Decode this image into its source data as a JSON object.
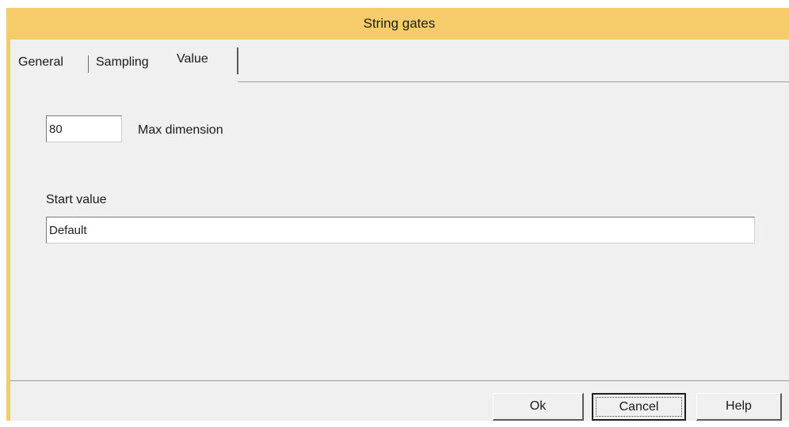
{
  "window": {
    "title": "String gates",
    "accent_color": "#f6cc6a",
    "background_color": "#f0f0f0"
  },
  "tabs": [
    {
      "label": "General",
      "active": false
    },
    {
      "label": "Sampling",
      "active": false
    },
    {
      "label": "Value",
      "active": true
    }
  ],
  "value_page": {
    "max_dimension": {
      "value": "80",
      "label": "Max dimension"
    },
    "start_value": {
      "label": "Start value",
      "value": "Default"
    }
  },
  "buttons": {
    "ok": "Ok",
    "cancel": "Cancel",
    "help": "Help"
  }
}
